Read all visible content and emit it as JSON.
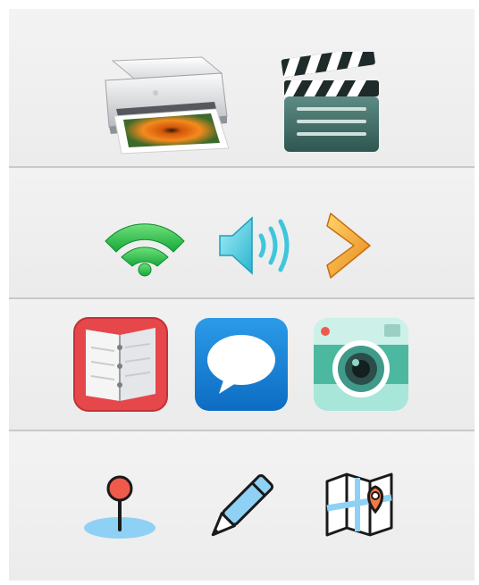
{
  "rows": [
    {
      "id": "hardware",
      "icons": [
        "printer-icon",
        "clapperboard-icon"
      ]
    },
    {
      "id": "status",
      "icons": [
        "wifi-icon",
        "speaker-volume-icon",
        "chevron-right-icon"
      ]
    },
    {
      "id": "apps",
      "icons": [
        "notebook-icon",
        "messages-icon",
        "camera-icon"
      ]
    },
    {
      "id": "tools",
      "icons": [
        "map-pin-icon",
        "pencil-icon",
        "map-icon"
      ]
    }
  ],
  "colors": {
    "background": "#efefef",
    "divider": "#c9c9c9",
    "wifi_green": "#2fc84f",
    "speaker_teal": "#3fc6dc",
    "chevron_orange": "#f6a322",
    "notebook_red": "#e5474b",
    "messages_blue": "#1a86d6",
    "camera_mint": "#7fd9c4",
    "pin_red": "#f05a4a",
    "map_orange": "#f37a42"
  }
}
